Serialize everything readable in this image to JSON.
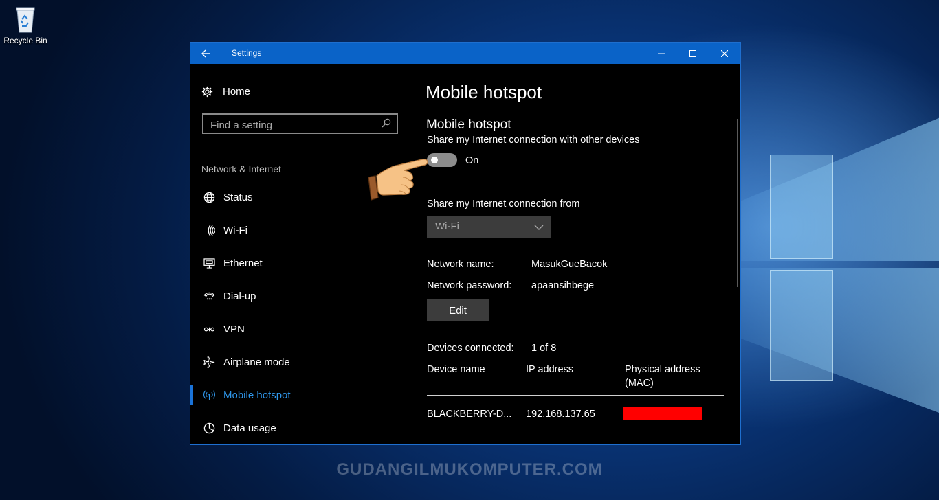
{
  "desktop": {
    "recycle_bin_label": "Recycle Bin",
    "watermark": "GUDANGILMUKOMPUTER.COM"
  },
  "window": {
    "title": "Settings",
    "back_icon": "arrow-left-icon",
    "controls": [
      "minimize-icon",
      "maximize-icon",
      "close-icon"
    ],
    "accent_color": "#0a63c8"
  },
  "sidebar": {
    "home_label": "Home",
    "search_placeholder": "Find a setting",
    "section_label": "Network & Internet",
    "items": [
      {
        "label": "Status",
        "icon": "globe-icon"
      },
      {
        "label": "Wi-Fi",
        "icon": "wifi-icon"
      },
      {
        "label": "Ethernet",
        "icon": "ethernet-icon"
      },
      {
        "label": "Dial-up",
        "icon": "dialup-icon"
      },
      {
        "label": "VPN",
        "icon": "vpn-icon"
      },
      {
        "label": "Airplane mode",
        "icon": "airplane-icon"
      },
      {
        "label": "Mobile hotspot",
        "icon": "hotspot-icon",
        "active": true
      },
      {
        "label": "Data usage",
        "icon": "pie-chart-icon"
      }
    ],
    "active_color": "#2f95e8"
  },
  "main": {
    "page_title": "Mobile hotspot",
    "section_title": "Mobile hotspot",
    "share_description": "Share my Internet connection with other devices",
    "toggle_state_label": "On",
    "share_from_label": "Share my Internet connection from",
    "share_from_value": "Wi-Fi",
    "network_name_label": "Network name:",
    "network_name_value": "MasukGueBacok",
    "network_password_label": "Network password:",
    "network_password_value": "apaansihbege",
    "edit_label": "Edit",
    "devices_connected_label": "Devices connected:",
    "devices_connected_value": "1 of 8",
    "table": {
      "headers": [
        "Device name",
        "IP address",
        "Physical address (MAC)"
      ],
      "header_mac_line1": "Physical address",
      "header_mac_line2": "(MAC)",
      "rows": [
        {
          "device": "BLACKBERRY-D...",
          "ip": "192.168.137.65",
          "mac_redacted": true
        }
      ]
    },
    "redaction_color": "#ff0000"
  }
}
